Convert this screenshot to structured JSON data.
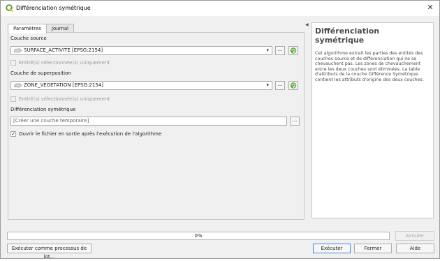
{
  "window": {
    "title": "Différenciation symétrique",
    "app_icon": "qgis-icon",
    "close_icon": "close-icon"
  },
  "tabs": [
    {
      "label": "Paramètres",
      "active": true
    },
    {
      "label": "Journal",
      "active": false
    }
  ],
  "params": {
    "source_label": "Couche source",
    "source_value": "SURFACE_ACTIVITE [EPSG:2154]",
    "source_selected_only": "Entité(s) sélectionnée(s) uniquement",
    "overlay_label": "Couche de superposition",
    "overlay_value": "ZONE_VEGETATION [EPSG:2154]",
    "overlay_selected_only": "Entité(s) sélectionnée(s) uniquement",
    "output_label": "Différenciation symétrique",
    "output_placeholder": "[Créer une couche temporaire]",
    "open_output_label": "Ouvrir le fichier en sortie après l'exécution de l'algorithme",
    "open_output_checked": true,
    "browse_label": "...",
    "dropdown_arrow": "▾"
  },
  "help": {
    "title": "Différenciation symétrique",
    "text": "Cet algorithme extrait les parties des entités des couches source et de différenciation qui ne se chevauchent pas. Les zones de chevauchement entre les deux couches sont éliminées. La table d'attributs de la couche Différence Symétrique contient les attributs d'origine des deux couches."
  },
  "progress": {
    "value": 0,
    "label": "0%"
  },
  "buttons": {
    "cancel": "Annuler",
    "batch": "Exécuter comme processus de lot...",
    "run": "Exécuter",
    "close": "Fermer",
    "help": "Aide"
  },
  "colors": {
    "accent": "#3b8be0",
    "qgis_green": "#589632",
    "qgis_yellow": "#eec90d"
  }
}
